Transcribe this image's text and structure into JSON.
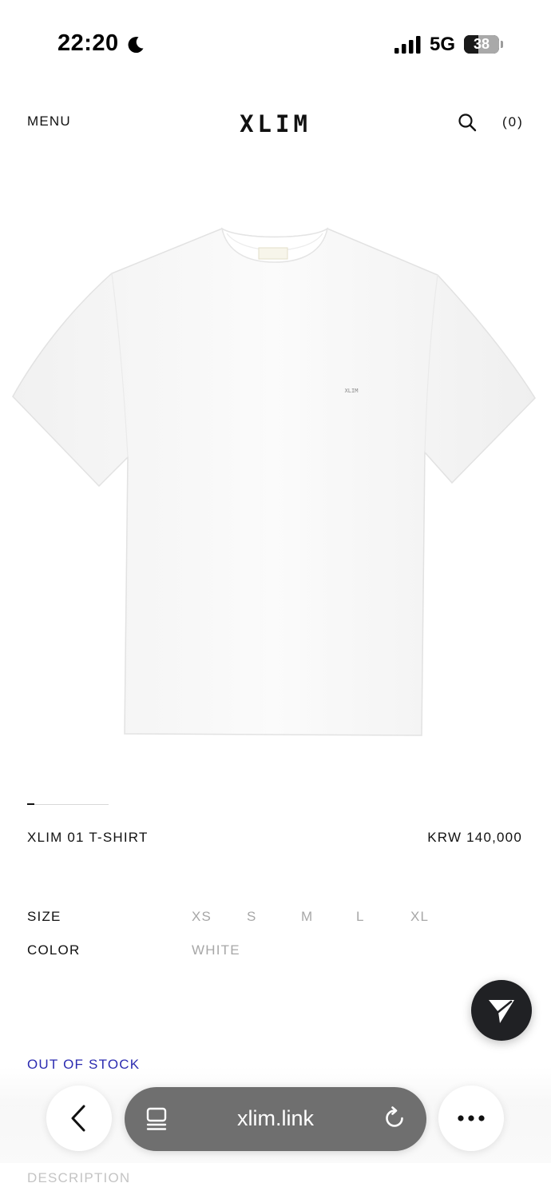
{
  "status_bar": {
    "time": "22:20",
    "network": "5G",
    "battery": "38",
    "battery_level_percent": 38,
    "icons": [
      "moon-icon",
      "signal-icon",
      "battery-icon"
    ]
  },
  "header": {
    "menu_label": "MENU",
    "brand": "XLIM",
    "cart_count": "(0)",
    "icons": [
      "search-icon"
    ]
  },
  "product": {
    "image_logo_text": "XLIM",
    "name": "XLIM 01 T-SHIRT",
    "price": "KRW 140,000",
    "size_label": "SIZE",
    "sizes": [
      "XS",
      "S",
      "M",
      "L",
      "XL"
    ],
    "color_label": "COLOR",
    "colors": [
      "WHITE"
    ],
    "stock_status": "OUT OF STOCK",
    "description_label": "DESCRIPTION",
    "carousel": {
      "current_slide": 1
    }
  },
  "browser": {
    "url": "xlim.link",
    "icons": [
      "chevron-left-icon",
      "tab-overview-icon",
      "reload-icon",
      "more-icon",
      "send-icon"
    ]
  },
  "colors": {
    "text": "#111111",
    "muted": "#a7a7a7",
    "out_of_stock": "#2b2bb0",
    "address_bar": "#6f6f6f",
    "fab": "#202124"
  }
}
